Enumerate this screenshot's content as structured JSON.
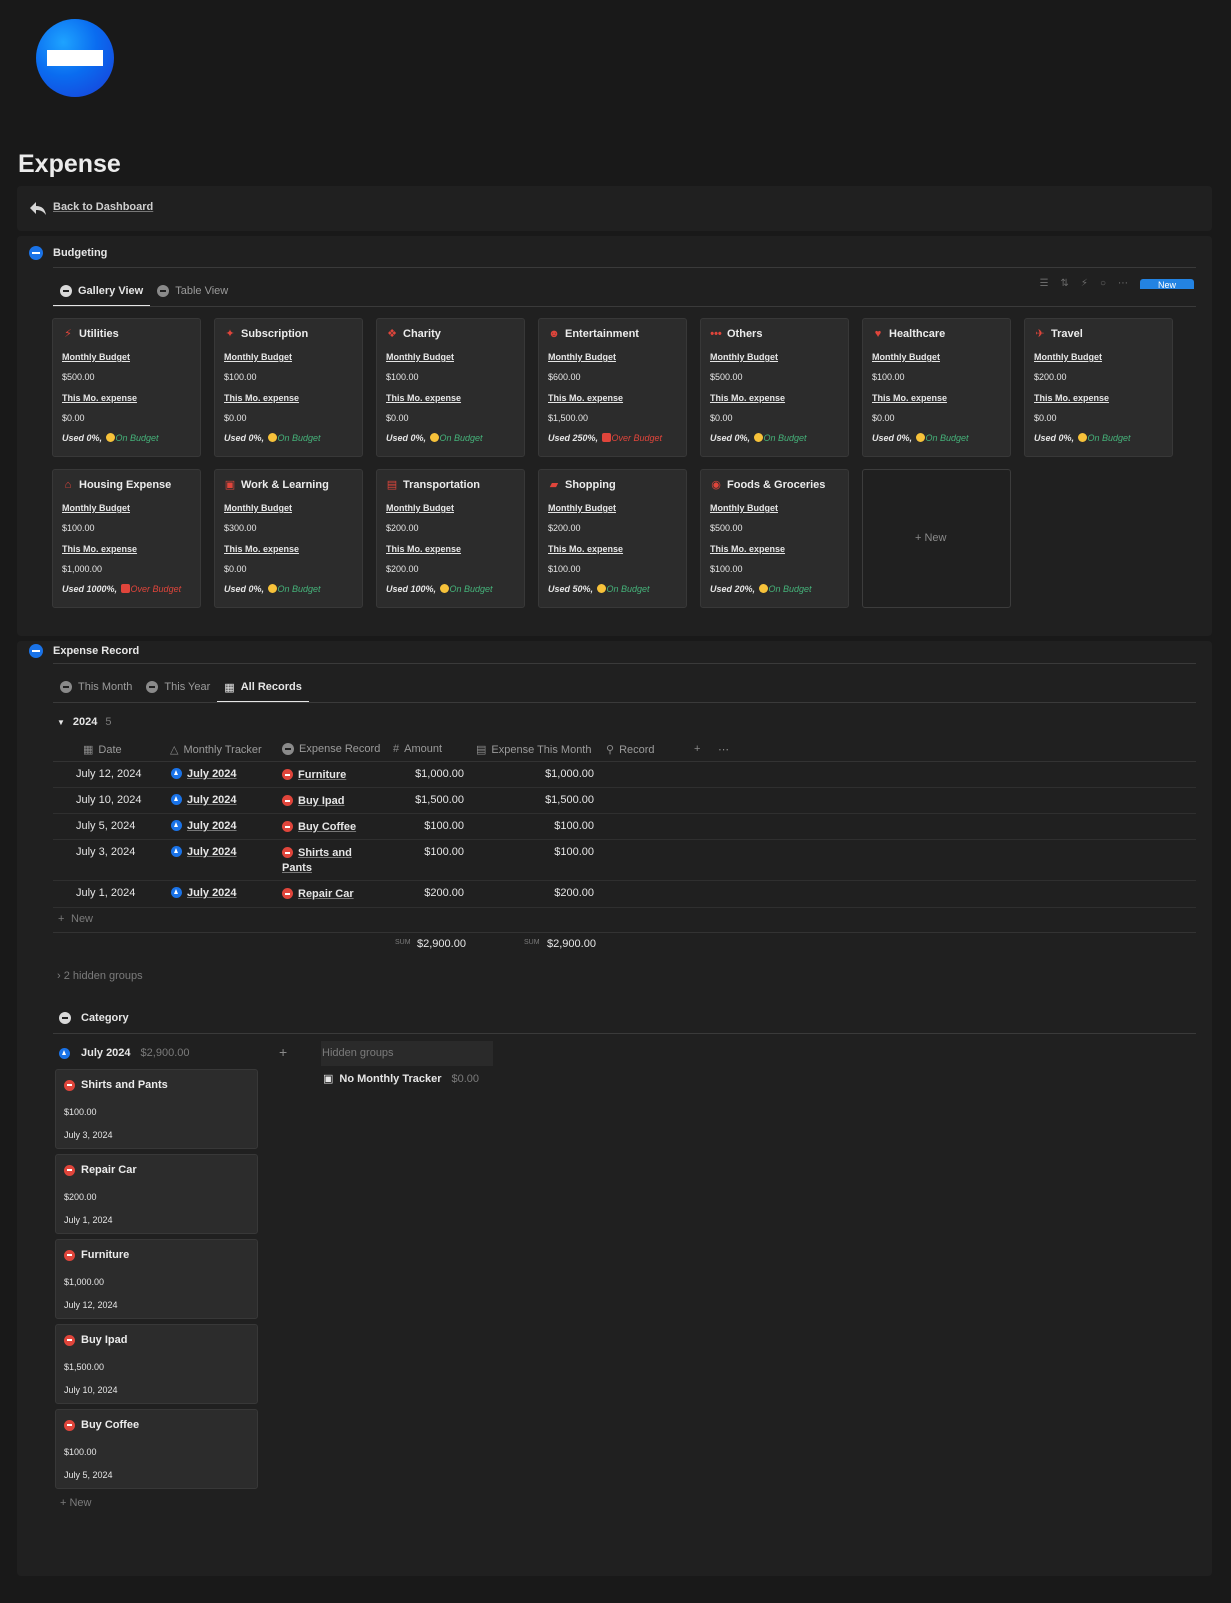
{
  "page": {
    "title": "Expense"
  },
  "back": {
    "label": "Back to Dashboard"
  },
  "budgeting": {
    "title": "Budgeting",
    "tabs": [
      "Gallery View",
      "Table View"
    ],
    "new_label": "New",
    "card_labels": {
      "budget": "Monthly Budget",
      "expense": "This Mo. expense"
    },
    "cards": [
      {
        "name": "Utilities",
        "icon": "plug-icon",
        "glyph": "⚡",
        "budget": "$500.00",
        "expense": "$0.00",
        "used": "Used 0%,",
        "status": "On Budget",
        "over": false
      },
      {
        "name": "Subscription",
        "icon": "megaphone-icon",
        "glyph": "✦",
        "budget": "$100.00",
        "expense": "$0.00",
        "used": "Used 0%,",
        "status": "On Budget",
        "over": false
      },
      {
        "name": "Charity",
        "icon": "gift-icon",
        "glyph": "❖",
        "budget": "$100.00",
        "expense": "$0.00",
        "used": "Used 0%,",
        "status": "On Budget",
        "over": false
      },
      {
        "name": "Entertainment",
        "icon": "mask-icon",
        "glyph": "☻",
        "budget": "$600.00",
        "expense": "$1,500.00",
        "used": "Used 250%,",
        "status": "Over Budget",
        "over": true
      },
      {
        "name": "Others",
        "icon": "dots-icon",
        "glyph": "•••",
        "budget": "$500.00",
        "expense": "$0.00",
        "used": "Used 0%,",
        "status": "On Budget",
        "over": false
      },
      {
        "name": "Healthcare",
        "icon": "heart-pulse-icon",
        "glyph": "♥",
        "budget": "$100.00",
        "expense": "$0.00",
        "used": "Used 0%,",
        "status": "On Budget",
        "over": false
      },
      {
        "name": "Travel",
        "icon": "airplane-icon",
        "glyph": "✈",
        "budget": "$200.00",
        "expense": "$0.00",
        "used": "Used 0%,",
        "status": "On Budget",
        "over": false
      },
      {
        "name": "Housing Expense",
        "icon": "house-icon",
        "glyph": "⌂",
        "budget": "$100.00",
        "expense": "$1,000.00",
        "used": "Used 1000%,",
        "status": "Over Budget",
        "over": true
      },
      {
        "name": "Work & Learning",
        "icon": "briefcase-icon",
        "glyph": "▣",
        "budget": "$300.00",
        "expense": "$0.00",
        "used": "Used 0%,",
        "status": "On Budget",
        "over": false
      },
      {
        "name": "Transportation",
        "icon": "car-icon",
        "glyph": "▤",
        "budget": "$200.00",
        "expense": "$200.00",
        "used": "Used 100%,",
        "status": "On Budget",
        "over": false
      },
      {
        "name": "Shopping",
        "icon": "shopping-bag-icon",
        "glyph": "▰",
        "budget": "$200.00",
        "expense": "$100.00",
        "used": "Used 50%,",
        "status": "On Budget",
        "over": false
      },
      {
        "name": "Foods & Groceries",
        "icon": "utensils-icon",
        "glyph": "◉",
        "budget": "$500.00",
        "expense": "$100.00",
        "used": "Used 20%,",
        "status": "On Budget",
        "over": false
      }
    ],
    "new_card_label": "+ New"
  },
  "records": {
    "title": "Expense Record",
    "tabs": [
      "This Month",
      "This Year",
      "All Records"
    ],
    "group": {
      "label": "2024",
      "count": "5"
    },
    "columns": [
      "Date",
      "Monthly Tracker",
      "Expense Record",
      "Amount",
      "Expense This Month",
      "Record"
    ],
    "rows": [
      {
        "date": "July 12, 2024",
        "tracker": "July 2024",
        "record": "Furniture",
        "amount": "$1,000.00",
        "month": "$1,000.00"
      },
      {
        "date": "July 10, 2024",
        "tracker": "July 2024",
        "record": "Buy Ipad",
        "amount": "$1,500.00",
        "month": "$1,500.00"
      },
      {
        "date": "July 5, 2024",
        "tracker": "July 2024",
        "record": "Buy Coffee",
        "amount": "$100.00",
        "month": "$100.00"
      },
      {
        "date": "July 3, 2024",
        "tracker": "July 2024",
        "record_line1": "Shirts and",
        "record_line2": "Pants",
        "amount": "$100.00",
        "month": "$100.00"
      },
      {
        "date": "July 1, 2024",
        "tracker": "July 2024",
        "record": "Repair Car",
        "amount": "$200.00",
        "month": "$200.00"
      }
    ],
    "new_label": "New",
    "sum_label": "SUM",
    "sum_amount": "$2,900.00",
    "sum_month": "$2,900.00",
    "hidden_groups": "2 hidden groups"
  },
  "category": {
    "title": "Category",
    "column": {
      "label": "July 2024",
      "total": "$2,900.00"
    },
    "cards": [
      {
        "name": "Shirts and Pants",
        "amount": "$100.00",
        "date": "July 3, 2024"
      },
      {
        "name": "Repair Car",
        "amount": "$200.00",
        "date": "July 1, 2024"
      },
      {
        "name": "Furniture",
        "amount": "$1,000.00",
        "date": "July 12, 2024"
      },
      {
        "name": "Buy Ipad",
        "amount": "$1,500.00",
        "date": "July 10, 2024"
      },
      {
        "name": "Buy Coffee",
        "amount": "$100.00",
        "date": "July 5, 2024"
      }
    ],
    "new_label": "New",
    "hidden_groups_label": "Hidden groups",
    "no_tracker": {
      "label": "No Monthly Tracker",
      "total": "$0.00"
    }
  },
  "colors": {
    "accent": "#2383e2",
    "danger": "#e0453b",
    "ok": "#45b37a",
    "bg": "#191919",
    "block": "#202020"
  }
}
